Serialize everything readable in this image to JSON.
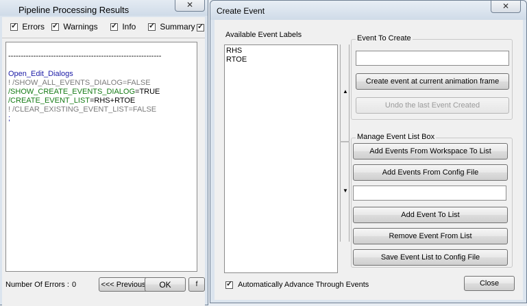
{
  "left_window": {
    "title": "Pipeline Processing Results",
    "filters": [
      {
        "label": "Errors",
        "checked": true
      },
      {
        "label": "Warnings",
        "checked": true
      },
      {
        "label": "Info",
        "checked": true
      },
      {
        "label": "Summary",
        "checked": true
      }
    ],
    "log_lines": [
      {
        "text": "----------------------------------------------------------------------",
        "color": "#000000"
      },
      {
        "text": "",
        "color": "#000000"
      },
      {
        "text": "Open_Edit_Dialogs",
        "color": "#1a1aa6"
      },
      {
        "text": "! /SHOW_ALL_EVENTS_DIALOG=FALSE",
        "color": "#7a7a7a"
      },
      {
        "text": "/SHOW_CREATE_EVENTS_DIALOG",
        "color": "#137a13",
        "suffix": "=TRUE"
      },
      {
        "text": "/CREATE_EVENT_LIST",
        "color": "#137a13",
        "suffix": "=RHS+RTOE"
      },
      {
        "text": "! /CLEAR_EXISTING_EVENT_LIST=FALSE",
        "color": "#7a7a7a"
      },
      {
        "text": ";",
        "color": "#1a1aa6"
      }
    ],
    "error_count_label": "Number Of Errors :",
    "error_count": "0",
    "previous_label": "<<< Previous",
    "ok_label": "OK"
  },
  "dialog": {
    "title": "Create Event",
    "available_label": "Available Event Labels",
    "event_labels": [
      "RHS",
      "RTOE"
    ],
    "event_to_create": {
      "group_label": "Event To Create",
      "input_value": "",
      "create_label": "Create event at current animation frame",
      "undo_label": "Undo the last Event Created"
    },
    "manage": {
      "group_label": "Manage Event List Box",
      "add_workspace_label": "Add Events From Workspace To List",
      "add_config_label": "Add Events From Config File",
      "input_value": "",
      "add_event_label": "Add Event To List",
      "remove_event_label": "Remove Event From List",
      "save_label": "Save Event List to Config File"
    },
    "auto_advance_label": "Automatically Advance Through Events",
    "auto_advance_checked": true,
    "close_label": "Close"
  },
  "icons": {
    "close": "close-icon",
    "scroll_up": "scroll-up-arrow-icon",
    "scroll_down": "scroll-down-arrow-icon"
  },
  "colors": {
    "frame": "#dbe4ee",
    "client": "#f0f0f0",
    "close_x": "#333333"
  }
}
